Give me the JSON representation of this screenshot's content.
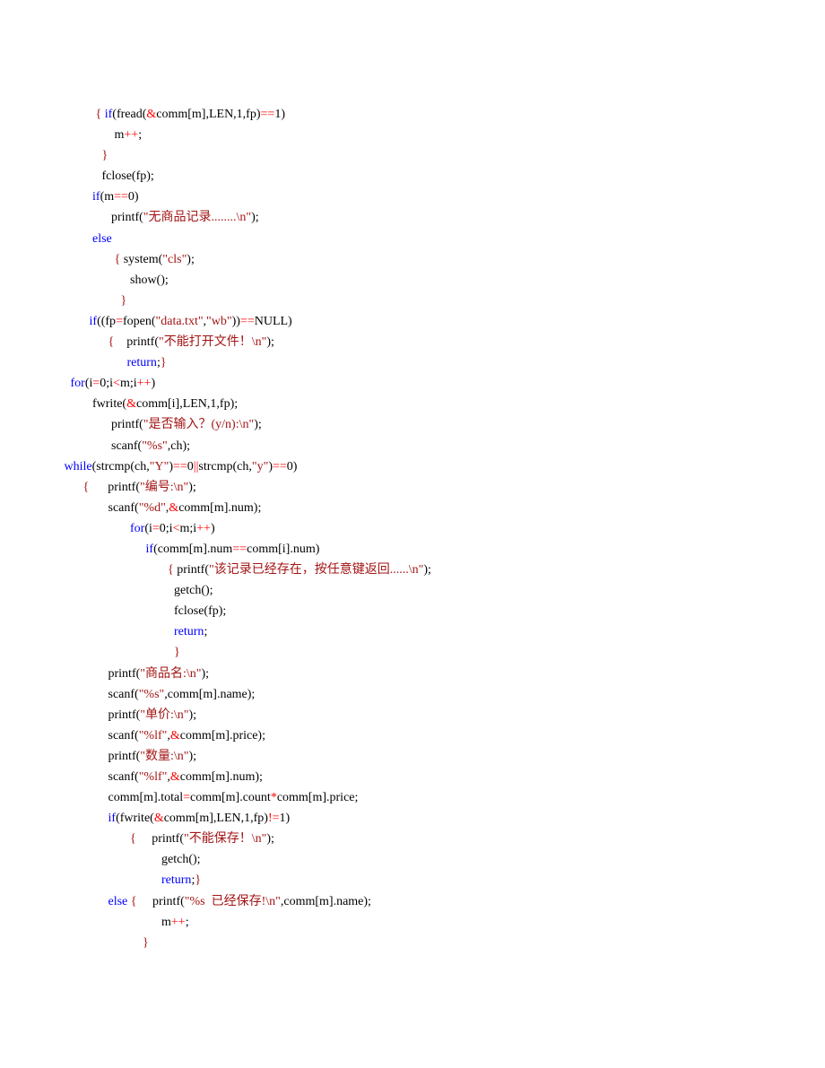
{
  "code_lines": [
    {
      "indent": "                   ",
      "tokens": [
        {
          "t": "{ ",
          "c": "br"
        },
        {
          "t": "if",
          "c": "kw"
        },
        {
          "t": "(fread("
        },
        {
          "t": "&",
          "c": "op"
        },
        {
          "t": "comm[m],LEN,1,fp)"
        },
        {
          "t": "==",
          "c": "op"
        },
        {
          "t": "1)"
        }
      ]
    },
    {
      "indent": "                         ",
      "tokens": [
        {
          "t": "m"
        },
        {
          "t": "++",
          "c": "op"
        },
        {
          "t": ";"
        }
      ]
    },
    {
      "indent": "                     ",
      "tokens": [
        {
          "t": "}",
          "c": "br"
        }
      ]
    },
    {
      "indent": "                     ",
      "tokens": [
        {
          "t": "fclose(fp);"
        }
      ]
    },
    {
      "indent": "                  ",
      "tokens": [
        {
          "t": "if",
          "c": "kw"
        },
        {
          "t": "(m"
        },
        {
          "t": "==",
          "c": "op"
        },
        {
          "t": "0)"
        }
      ]
    },
    {
      "indent": "                        ",
      "tokens": [
        {
          "t": "printf("
        },
        {
          "t": "\"无商品记录........\\n\"",
          "c": "str"
        },
        {
          "t": ");"
        }
      ]
    },
    {
      "indent": "                  ",
      "tokens": [
        {
          "t": "else",
          "c": "kw"
        }
      ]
    },
    {
      "indent": "                         ",
      "tokens": [
        {
          "t": "{ ",
          "c": "br"
        },
        {
          "t": "system("
        },
        {
          "t": "\"cls\"",
          "c": "str"
        },
        {
          "t": ");"
        }
      ]
    },
    {
      "indent": "                              ",
      "tokens": [
        {
          "t": "show();"
        }
      ]
    },
    {
      "indent": "                           ",
      "tokens": [
        {
          "t": "}",
          "c": "br"
        }
      ]
    },
    {
      "indent": "                 ",
      "tokens": [
        {
          "t": "if",
          "c": "kw"
        },
        {
          "t": "((fp"
        },
        {
          "t": "=",
          "c": "op"
        },
        {
          "t": "fopen("
        },
        {
          "t": "\"data.txt\"",
          "c": "str"
        },
        {
          "t": ","
        },
        {
          "t": "\"wb\"",
          "c": "str"
        },
        {
          "t": "))"
        },
        {
          "t": "==",
          "c": "op"
        },
        {
          "t": "NULL)"
        }
      ]
    },
    {
      "indent": "                       ",
      "tokens": [
        {
          "t": "{    ",
          "c": "br"
        },
        {
          "t": "printf("
        },
        {
          "t": "\"不能打开文件！\\n\"",
          "c": "str"
        },
        {
          "t": ");"
        }
      ]
    },
    {
      "indent": "                             ",
      "tokens": [
        {
          "t": "return",
          "c": "kw"
        },
        {
          "t": ";"
        },
        {
          "t": "}",
          "c": "br"
        }
      ]
    },
    {
      "indent": "           ",
      "tokens": [
        {
          "t": "for",
          "c": "kw"
        },
        {
          "t": "(i"
        },
        {
          "t": "=",
          "c": "op"
        },
        {
          "t": "0;i"
        },
        {
          "t": "<",
          "c": "op"
        },
        {
          "t": "m;i"
        },
        {
          "t": "++",
          "c": "op"
        },
        {
          "t": ")"
        }
      ]
    },
    {
      "indent": "                  ",
      "tokens": [
        {
          "t": "fwrite("
        },
        {
          "t": "&",
          "c": "op"
        },
        {
          "t": "comm[i],LEN,1,fp);"
        }
      ]
    },
    {
      "indent": "                        ",
      "tokens": [
        {
          "t": "printf("
        },
        {
          "t": "\"是否输入？(y/n):\\n\"",
          "c": "str"
        },
        {
          "t": ");"
        }
      ]
    },
    {
      "indent": "                        ",
      "tokens": [
        {
          "t": "scanf("
        },
        {
          "t": "\"%s\"",
          "c": "str"
        },
        {
          "t": ",ch);"
        }
      ]
    },
    {
      "indent": "         ",
      "tokens": [
        {
          "t": "while",
          "c": "kw"
        },
        {
          "t": "(strcmp(ch,"
        },
        {
          "t": "\"Y\"",
          "c": "str"
        },
        {
          "t": ")"
        },
        {
          "t": "==",
          "c": "op"
        },
        {
          "t": "0"
        },
        {
          "t": "||",
          "c": "op"
        },
        {
          "t": "strcmp(ch,"
        },
        {
          "t": "\"y\"",
          "c": "str"
        },
        {
          "t": ")"
        },
        {
          "t": "==",
          "c": "op"
        },
        {
          "t": "0)"
        }
      ]
    },
    {
      "indent": "               ",
      "tokens": [
        {
          "t": "{      ",
          "c": "br"
        },
        {
          "t": "printf("
        },
        {
          "t": "\"编号:\\n\"",
          "c": "str"
        },
        {
          "t": ");"
        }
      ]
    },
    {
      "indent": "                       ",
      "tokens": [
        {
          "t": "scanf("
        },
        {
          "t": "\"%d\"",
          "c": "str"
        },
        {
          "t": ","
        },
        {
          "t": "&",
          "c": "op"
        },
        {
          "t": "comm[m].num);"
        }
      ]
    },
    {
      "indent": "                              ",
      "tokens": [
        {
          "t": "for",
          "c": "kw"
        },
        {
          "t": "(i"
        },
        {
          "t": "=",
          "c": "op"
        },
        {
          "t": "0;i"
        },
        {
          "t": "<",
          "c": "op"
        },
        {
          "t": "m;i"
        },
        {
          "t": "++",
          "c": "op"
        },
        {
          "t": ")"
        }
      ]
    },
    {
      "indent": "                                   ",
      "tokens": [
        {
          "t": "if",
          "c": "kw"
        },
        {
          "t": "(comm[m].num"
        },
        {
          "t": "==",
          "c": "op"
        },
        {
          "t": "comm[i].num)"
        }
      ]
    },
    {
      "indent": "                                          ",
      "tokens": [
        {
          "t": "{ ",
          "c": "br"
        },
        {
          "t": "printf("
        },
        {
          "t": "\"该记录已经存在，按任意键返回......\\n\"",
          "c": "str"
        },
        {
          "t": ");"
        }
      ]
    },
    {
      "indent": "                                            ",
      "tokens": [
        {
          "t": "getch();"
        }
      ]
    },
    {
      "indent": "                                            ",
      "tokens": [
        {
          "t": "fclose(fp);"
        }
      ]
    },
    {
      "indent": "                                            ",
      "tokens": [
        {
          "t": "return",
          "c": "kw"
        },
        {
          "t": ";"
        }
      ]
    },
    {
      "indent": "                                            ",
      "tokens": [
        {
          "t": "}",
          "c": "br"
        }
      ]
    },
    {
      "indent": "                       ",
      "tokens": [
        {
          "t": "printf("
        },
        {
          "t": "\"商品名:\\n\"",
          "c": "str"
        },
        {
          "t": ");"
        }
      ]
    },
    {
      "indent": "                       ",
      "tokens": [
        {
          "t": "scanf("
        },
        {
          "t": "\"%s\"",
          "c": "str"
        },
        {
          "t": ",comm[m].name);"
        }
      ]
    },
    {
      "indent": "                       ",
      "tokens": [
        {
          "t": "printf("
        },
        {
          "t": "\"单价:\\n\"",
          "c": "str"
        },
        {
          "t": ");"
        }
      ]
    },
    {
      "indent": "                       ",
      "tokens": [
        {
          "t": "scanf("
        },
        {
          "t": "\"%lf\"",
          "c": "str"
        },
        {
          "t": ","
        },
        {
          "t": "&",
          "c": "op"
        },
        {
          "t": "comm[m].price);"
        }
      ]
    },
    {
      "indent": "                       ",
      "tokens": [
        {
          "t": "printf("
        },
        {
          "t": "\"数量:\\n\"",
          "c": "str"
        },
        {
          "t": ");"
        }
      ]
    },
    {
      "indent": "                       ",
      "tokens": [
        {
          "t": "scanf("
        },
        {
          "t": "\"%lf\"",
          "c": "str"
        },
        {
          "t": ","
        },
        {
          "t": "&",
          "c": "op"
        },
        {
          "t": "comm[m].num);"
        }
      ]
    },
    {
      "indent": "                       ",
      "tokens": [
        {
          "t": "comm[m].total"
        },
        {
          "t": "=",
          "c": "op"
        },
        {
          "t": "comm[m].count"
        },
        {
          "t": "*",
          "c": "op"
        },
        {
          "t": "comm[m].price;"
        }
      ]
    },
    {
      "indent": "                       ",
      "tokens": [
        {
          "t": "if",
          "c": "kw"
        },
        {
          "t": "(fwrite("
        },
        {
          "t": "&",
          "c": "op"
        },
        {
          "t": "comm[m],LEN,1,fp)"
        },
        {
          "t": "!=",
          "c": "op"
        },
        {
          "t": "1)"
        }
      ]
    },
    {
      "indent": "                              ",
      "tokens": [
        {
          "t": "{     ",
          "c": "br"
        },
        {
          "t": "printf("
        },
        {
          "t": "\"不能保存！\\n\"",
          "c": "str"
        },
        {
          "t": ");"
        }
      ]
    },
    {
      "indent": "                                        ",
      "tokens": [
        {
          "t": "getch();"
        }
      ]
    },
    {
      "indent": "                                        ",
      "tokens": [
        {
          "t": "return",
          "c": "kw"
        },
        {
          "t": ";"
        },
        {
          "t": "}",
          "c": "br"
        }
      ]
    },
    {
      "indent": "                       ",
      "tokens": [
        {
          "t": "else",
          "c": "kw"
        },
        {
          "t": " "
        },
        {
          "t": "{     ",
          "c": "br"
        },
        {
          "t": "printf("
        },
        {
          "t": "\"%s  已经保存!\\n\"",
          "c": "str"
        },
        {
          "t": ",comm[m].name);"
        }
      ]
    },
    {
      "indent": "                                        ",
      "tokens": [
        {
          "t": "m"
        },
        {
          "t": "++",
          "c": "op"
        },
        {
          "t": ";"
        }
      ]
    },
    {
      "indent": "                                  ",
      "tokens": [
        {
          "t": "}",
          "c": "br"
        }
      ]
    }
  ]
}
